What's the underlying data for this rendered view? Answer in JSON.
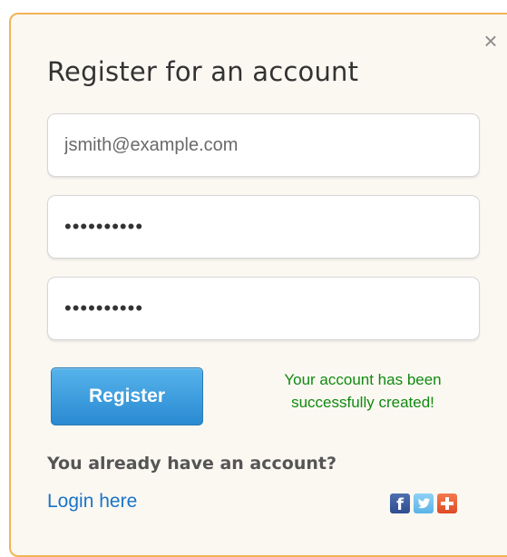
{
  "dialog": {
    "title": "Register for an account",
    "close_symbol": "×"
  },
  "form": {
    "email_value": "jsmith@example.com",
    "password_value": "••••••••••",
    "confirm_password_value": "••••••••••",
    "register_label": "Register"
  },
  "status": {
    "line1": "Your account has been",
    "line2": "successfully created!"
  },
  "footer": {
    "question": "You already have an account?",
    "login_label": "Login here",
    "facebook_glyph": "f"
  },
  "social_icons": [
    "facebook-icon",
    "twitter-icon",
    "google-plus-icon"
  ],
  "colors": {
    "panel_border": "#f2b456",
    "panel_background": "#fbf8f2",
    "register_button": "#2a8ad2",
    "success_text": "#118a11",
    "link": "#1a73c8"
  }
}
